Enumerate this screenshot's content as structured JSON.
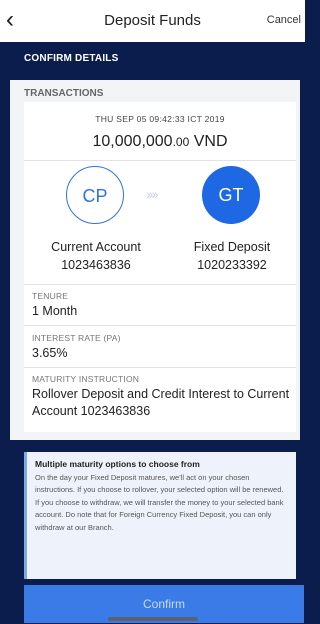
{
  "header": {
    "back_icon": "chevron-left-icon",
    "title": "Deposit Funds",
    "cancel_label": "Cancel"
  },
  "section": {
    "title": "CONFIRM DETAILS"
  },
  "transactions": {
    "label": "TRANSACTIONS",
    "date": "THU SEP 05 09:42:33 ICT 2019",
    "amount_main": "10,000,000",
    "amount_dec": ".00",
    "currency": "VND",
    "from": {
      "initials": "CP",
      "name": "Current Account",
      "number": "1023463836"
    },
    "to": {
      "initials": "GT",
      "name": "Fixed Deposit",
      "number": "1020233392"
    },
    "transfer_arrows": "››››",
    "tenure_label": "TENURE",
    "tenure_value": "1 Month",
    "rate_label": "INTEREST RATE (PA)",
    "rate_value": "3.65%",
    "maturity_label": "MATURITY INSTRUCTION",
    "maturity_value": "Rollover Deposit and Credit Interest to Current Account 1023463836"
  },
  "info": {
    "title": "Multiple maturity options to choose from",
    "body": "On the day your Fixed Deposit matures, we'll act on your chosen instructions. If you choose to rollover, your selected option will be renewed. If you choose to withdraw, we will transfer the money to your selected bank account. Do note that for Foreign Currency Fixed Deposit, you can only withdraw at our Branch."
  },
  "confirm_label": "Confirm",
  "colors": {
    "navy": "#0b1d4d",
    "accent": "#2f72e8",
    "button": "#3b7be8"
  }
}
